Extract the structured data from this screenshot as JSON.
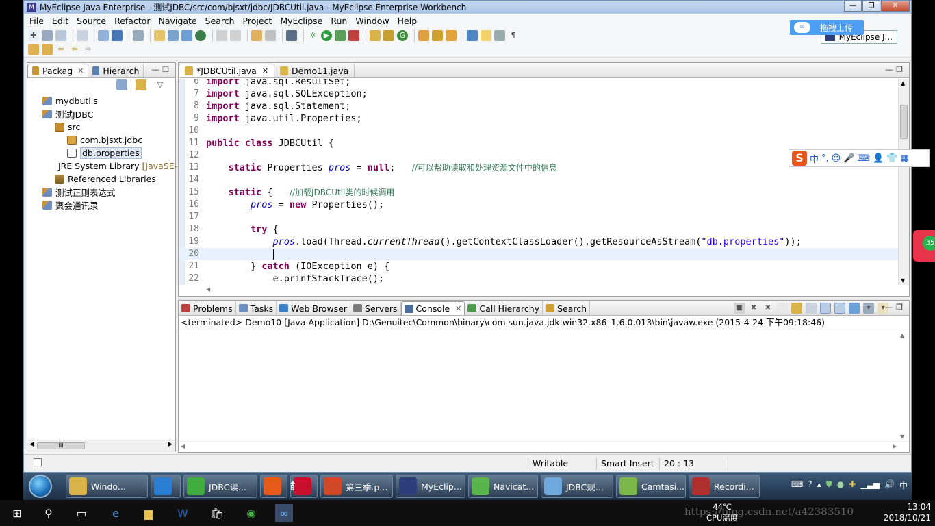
{
  "window": {
    "title": "MyEclipse Java Enterprise - 测试JDBC/src/com/bjsxt/jdbc/JDBCUtil.java - MyEclipse Enterprise Workbench"
  },
  "menu": [
    "File",
    "Edit",
    "Source",
    "Refactor",
    "Navigate",
    "Search",
    "Project",
    "MyEclipse",
    "Run",
    "Window",
    "Help"
  ],
  "perspective": "MyEclipse J...",
  "upload_widget": {
    "label": "拖拽上传"
  },
  "explorer": {
    "tabs": [
      {
        "label": "Packag"
      },
      {
        "label": "Hierarch"
      }
    ],
    "tree": [
      {
        "label": "mydbutils",
        "level": 0,
        "icon": "project-icon"
      },
      {
        "label": "测试JDBC",
        "level": 0,
        "icon": "project-icon"
      },
      {
        "label": "src",
        "level": 1,
        "icon": "source-folder-icon"
      },
      {
        "label": "com.bjsxt.jdbc",
        "level": 2,
        "icon": "package-icon"
      },
      {
        "label": "db.properties",
        "level": 2,
        "icon": "file-icon",
        "selected": true
      },
      {
        "label": "JRE System Library",
        "decoration": "[JavaSE-",
        "level": 1,
        "icon": "library-icon"
      },
      {
        "label": "Referenced Libraries",
        "level": 1,
        "icon": "library-icon"
      },
      {
        "label": "测试正则表达式",
        "level": 0,
        "icon": "project-icon"
      },
      {
        "label": "聚会通讯录",
        "level": 0,
        "icon": "project-icon"
      }
    ],
    "scrollbar_thumb": "III"
  },
  "editor": {
    "tabs": [
      {
        "label": "*JDBCUtil.java",
        "active": true
      },
      {
        "label": "Demo11.java",
        "active": false
      }
    ],
    "lines": [
      {
        "n": "6",
        "html": "<span class=\"kw\">import</span> java.sql.ResultSet;"
      },
      {
        "n": "7",
        "html": "<span class=\"kw\">import</span> java.sql.SQLException;"
      },
      {
        "n": "8",
        "html": "<span class=\"kw\">import</span> java.sql.Statement;"
      },
      {
        "n": "9",
        "html": "<span class=\"kw\">import</span> java.util.Properties;"
      },
      {
        "n": "10",
        "html": ""
      },
      {
        "n": "11",
        "html": "<span class=\"kw\">public class</span> JDBCUtil {"
      },
      {
        "n": "12",
        "html": ""
      },
      {
        "n": "13",
        "html": "    <span class=\"kw\">static</span> Properties <span class=\"fld\">pros</span> = <span class=\"kw\">null</span>;   <span class=\"cmt\">//可以帮助读取和处理资源文件中的信息</span>"
      },
      {
        "n": "14",
        "html": ""
      },
      {
        "n": "15",
        "html": "    <span class=\"kw\">static</span> {   <span class=\"cmt\">//加载JDBCUtil类的时候调用</span>"
      },
      {
        "n": "16",
        "html": "        <span class=\"fld\">pros</span> = <span class=\"kw\">new</span> Properties();"
      },
      {
        "n": "17",
        "html": ""
      },
      {
        "n": "18",
        "html": "        <span class=\"kw\">try</span> {"
      },
      {
        "n": "19",
        "html": "            <span class=\"fld\">pros</span>.load(Thread.<span class=\"it\">currentThread</span>().getContextClassLoader().getResourceAsStream(<span class=\"str\">\"db.properties\"</span>));"
      },
      {
        "n": "20",
        "html": "            ",
        "current": true
      },
      {
        "n": "21",
        "html": "        } <span class=\"kw\">catch</span> (IOException e) {"
      },
      {
        "n": "22",
        "html": "            e.printStackTrace();"
      }
    ]
  },
  "ime_bar": {
    "logo": "S",
    "mode": "中"
  },
  "console": {
    "tabs": [
      {
        "label": "Problems",
        "color": "#c04040"
      },
      {
        "label": "Tasks",
        "color": "#6a8fc0"
      },
      {
        "label": "Web Browser",
        "color": "#3b7fc4"
      },
      {
        "label": "Servers",
        "color": "#7a7a7a"
      },
      {
        "label": "Console",
        "color": "#4a6f9c",
        "active": true
      },
      {
        "label": "Call Hierarchy",
        "color": "#4c9a4c"
      },
      {
        "label": "Search",
        "color": "#d0a030"
      }
    ],
    "terminated_line": "<terminated> Demo10 [Java Application] D:\\Genuitec\\Common\\binary\\com.sun.java.jdk.win32.x86_1.6.0.013\\bin\\javaw.exe (2015-4-24 下午09:18:46)"
  },
  "statusbar": {
    "writable": "Writable",
    "insert_mode": "Smart Insert",
    "position": "20 : 13"
  },
  "win7_taskbar": {
    "tasks": [
      {
        "label": "Windo...",
        "color": "#d9b34a"
      },
      {
        "label": "",
        "color": "#2a7fd4"
      },
      {
        "label": "JDBC读...",
        "color": "#3fae3f"
      },
      {
        "label": "淘",
        "color": "#e85a1a"
      },
      {
        "label": "天猫",
        "color": "#c8102e"
      },
      {
        "label": "第三季.p...",
        "color": "#d24726"
      },
      {
        "label": "MyEclip...",
        "color": "#2d3f7a"
      },
      {
        "label": "Navicat...",
        "color": "#59b44a"
      },
      {
        "label": "JDBC规...",
        "color": "#6fa8dc"
      },
      {
        "label": "Camtasi...",
        "color": "#7ab648"
      },
      {
        "label": "Recordi...",
        "color": "#b03030"
      }
    ],
    "ime": "中"
  },
  "win10_taskbar": {
    "cpu_temp": "44℃",
    "cpu_label": "CPU温度",
    "time": "13:04",
    "date": "2018/10/21",
    "watermark": "https://blog.csdn.net/a42383510"
  },
  "side_badge": "35"
}
